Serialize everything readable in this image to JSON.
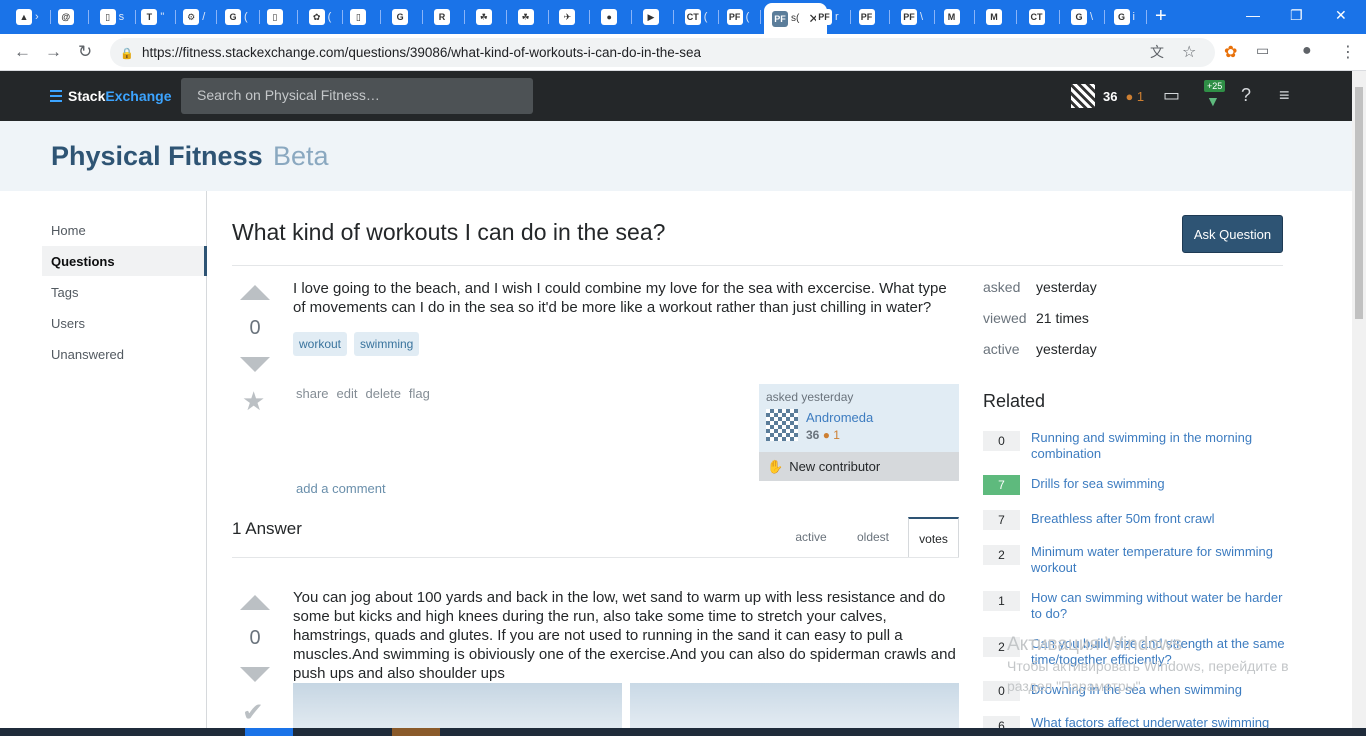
{
  "browser": {
    "tabs": [
      {
        "fav": "▲",
        "label": "›"
      },
      {
        "fav": "@",
        "label": ""
      },
      {
        "fav": "▯",
        "label": "s"
      },
      {
        "fav": "T",
        "label": "\""
      },
      {
        "fav": "⚙",
        "label": "/"
      },
      {
        "fav": "G",
        "label": "("
      },
      {
        "fav": "▯",
        "label": ""
      },
      {
        "fav": "✿",
        "label": "("
      },
      {
        "fav": "▯",
        "label": ""
      },
      {
        "fav": "G",
        "label": ""
      },
      {
        "fav": "R",
        "label": ""
      },
      {
        "fav": "☘",
        "label": ""
      },
      {
        "fav": "☘",
        "label": ""
      },
      {
        "fav": "✈",
        "label": ""
      },
      {
        "fav": "●",
        "label": ""
      },
      {
        "fav": "▶",
        "label": ""
      },
      {
        "fav": "CT",
        "label": "("
      },
      {
        "fav": "PF",
        "label": "("
      }
    ],
    "active_tab": {
      "fav": "PF",
      "label": "s("
    },
    "tabs_right": [
      {
        "fav": "PF",
        "label": "r"
      },
      {
        "fav": "PF",
        "label": ""
      },
      {
        "fav": "PF",
        "label": "\\"
      },
      {
        "fav": "M",
        "label": ""
      },
      {
        "fav": "M",
        "label": ""
      },
      {
        "fav": "CT",
        "label": ""
      },
      {
        "fav": "G",
        "label": "\\"
      },
      {
        "fav": "G",
        "label": "i"
      }
    ],
    "url": "https://fitness.stackexchange.com/questions/39086/what-kind-of-workouts-i-can-do-in-the-sea"
  },
  "topbar": {
    "logo_a": "Stack",
    "logo_b": "Exchange",
    "search_placeholder": "Search on Physical Fitness…",
    "reputation": "36",
    "bronze": "● 1",
    "achievement_badge": "+25"
  },
  "site": {
    "title": "Physical Fitness",
    "beta": "Beta"
  },
  "nav": [
    "Home",
    "Questions",
    "Tags",
    "Users",
    "Unanswered"
  ],
  "question": {
    "title": "What kind of workouts I can do in the sea?",
    "ask_label": "Ask Question",
    "votes": "0",
    "body": "I love going to the beach, and I wish I could combine my love for the sea with excercise. What type of movements can I do in the sea so it'd be more like a workout rather than just chilling in water?",
    "tags": [
      "workout",
      "swimming"
    ],
    "menu": [
      "share",
      "edit",
      "delete",
      "flag"
    ],
    "asked_label": "asked yesterday",
    "user_name": "Andromeda",
    "user_rep": "36",
    "user_bronze": "● 1",
    "new_contributor": "New contributor",
    "add_comment": "add a comment"
  },
  "answers": {
    "count_label": "1 Answer",
    "sort_tabs": [
      "active",
      "oldest",
      "votes"
    ],
    "votes": "0",
    "body": "You can jog about 100 yards and back in the low, wet sand to warm up with less resistance and do some but kicks and high knees during the run, also take some time to stretch your calves, hamstrings, quads and glutes. If you are not used to running in the sand it can easy to pull a muscles.And swimming is obiviously one of the exercise.And you can also do spiderman crawls and push ups and also shoulder ups"
  },
  "meta": [
    {
      "label": "asked",
      "value": "yesterday"
    },
    {
      "label": "viewed",
      "value": "21 times"
    },
    {
      "label": "active",
      "value": "yesterday"
    }
  ],
  "related": {
    "heading": "Related",
    "items": [
      {
        "score": "0",
        "title": "Running and swimming in the morning combination"
      },
      {
        "score": "7",
        "title": "Drills for sea swimming"
      },
      {
        "score": "7",
        "title": "Breathless after 50m front crawl"
      },
      {
        "score": "2",
        "title": "Minimum water temperature for swimming workout"
      },
      {
        "score": "1",
        "title": "How can swimming without water be harder to do?"
      },
      {
        "score": "2",
        "title": "Can you build size and strength at the same time/together efficiently?"
      },
      {
        "score": "0",
        "title": "Drowning in the sea when swimming"
      },
      {
        "score": "6",
        "title": "What factors affect underwater swimming"
      }
    ]
  },
  "watermark": {
    "line1": "Активация Windows",
    "line2": "Чтобы активировать Windows, перейдите в",
    "line3": "раздел \"Параметры\"."
  },
  "colors": {
    "accent": "#2e5474",
    "link": "#3d7cc0",
    "chrome_blue": "#1a73e8",
    "accepted": "#5eba7d"
  }
}
